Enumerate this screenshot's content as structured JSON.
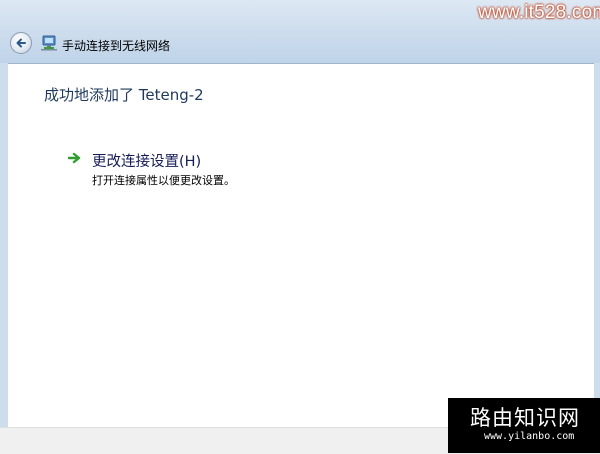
{
  "window": {
    "title": "手动连接到无线网络",
    "close_glyph": "×"
  },
  "main": {
    "heading": "成功地添加了 Teteng-2",
    "link": {
      "label": "更改连接设置(H)",
      "description": "打开连接属性以便更改设置。"
    }
  },
  "icons": {
    "back": "back-arrow-icon",
    "network": "wireless-network-icon",
    "link_arrow": "green-arrow-icon"
  },
  "colors": {
    "heading": "#1e395b",
    "link": "#151c55",
    "link_arrow": "#2e9f2e"
  },
  "watermarks": {
    "top_right": "www.it528.com",
    "bottom_title": "路由知识网",
    "bottom_url": "www.yilanbo.com"
  }
}
